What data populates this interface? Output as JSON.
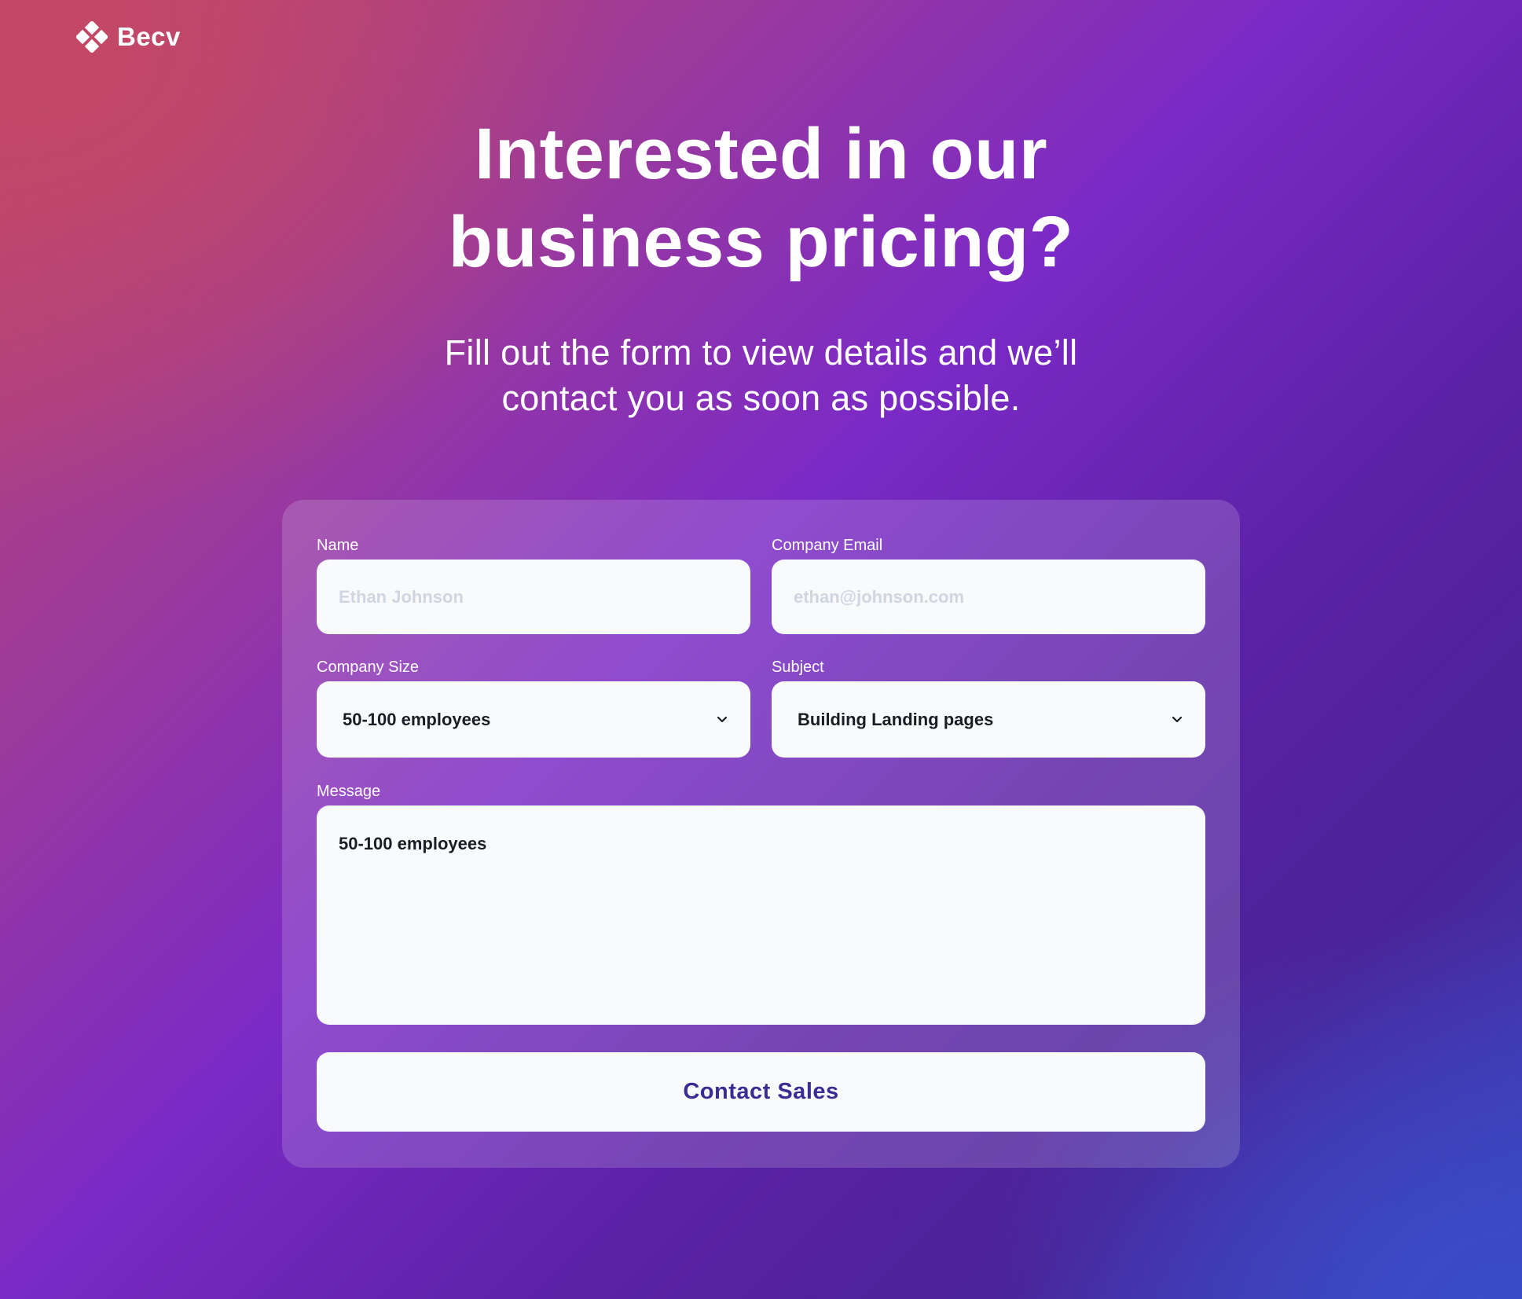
{
  "brand": {
    "name": "Becv",
    "logo_icon": "four-diamond-logo-icon"
  },
  "hero": {
    "title_line1": "Interested in our",
    "title_line2": "business pricing?",
    "subtitle_line1": "Fill out the form to view details and we’ll",
    "subtitle_line2": "contact you as soon as possible."
  },
  "form": {
    "name": {
      "label": "Name",
      "placeholder": "Ethan Johnson",
      "value": ""
    },
    "email": {
      "label": "Company Email",
      "placeholder": "ethan@johnson.com",
      "value": ""
    },
    "company_size": {
      "label": "Company Size",
      "selected": "50-100 employees",
      "icon": "chevron-down-icon"
    },
    "subject": {
      "label": "Subject",
      "selected": "Building Landing pages",
      "icon": "chevron-down-icon"
    },
    "message": {
      "label": "Message",
      "value": "50-100 employees"
    },
    "submit_label": "Contact Sales"
  },
  "colors": {
    "gradient_top_left": "#c1466c",
    "gradient_middle": "#7b2ac6",
    "gradient_bottom_right": "#3a46c0",
    "field_background": "#f8fafb",
    "placeholder_text": "#cfd6e2",
    "button_text": "#3b2b95"
  }
}
